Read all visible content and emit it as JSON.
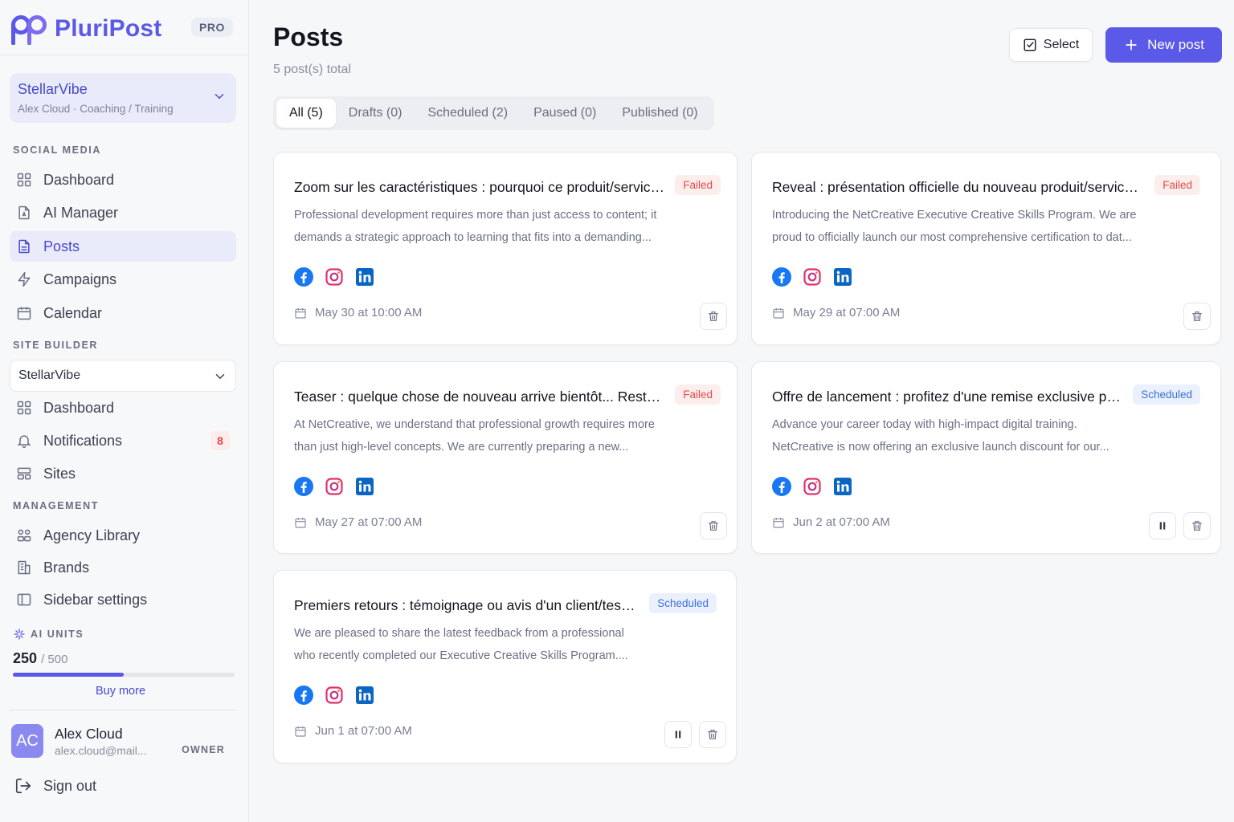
{
  "brand": {
    "name": "PluriPost",
    "badge": "PRO"
  },
  "workspace": {
    "name": "StellarVibe",
    "subtitle": "Alex Cloud · Coaching / Training"
  },
  "sidebar": {
    "social_label": "SOCIAL MEDIA",
    "social_items": [
      {
        "label": "Dashboard",
        "icon": "grid-icon"
      },
      {
        "label": "AI Manager",
        "icon": "document-ai-icon"
      },
      {
        "label": "Posts",
        "icon": "document-icon",
        "active": true
      },
      {
        "label": "Campaigns",
        "icon": "bolt-icon"
      },
      {
        "label": "Calendar",
        "icon": "calendar-icon"
      }
    ],
    "site_label": "SITE BUILDER",
    "site_select": "StellarVibe",
    "site_items": [
      {
        "label": "Dashboard",
        "icon": "grid-icon"
      },
      {
        "label": "Notifications",
        "icon": "bell-icon",
        "badge": "8"
      },
      {
        "label": "Sites",
        "icon": "layout-icon"
      }
    ],
    "management_label": "MANAGEMENT",
    "management_items": [
      {
        "label": "Agency Library",
        "icon": "library-icon"
      },
      {
        "label": "Brands",
        "icon": "building-icon"
      },
      {
        "label": "Sidebar settings",
        "icon": "sidebar-icon"
      }
    ],
    "ai_units": {
      "label": "AI UNITS",
      "used": "250",
      "total": "/ 500",
      "fraction": 0.5,
      "buy_more": "Buy more"
    },
    "user": {
      "initials": "AC",
      "name": "Alex Cloud",
      "email": "alex.cloud@mail...",
      "role": "OWNER"
    },
    "sign_out": "Sign out"
  },
  "header": {
    "title": "Posts",
    "subtitle": "5 post(s) total",
    "select_label": "Select",
    "new_post_label": "New post"
  },
  "tabs": [
    {
      "label": "All (5)",
      "active": true
    },
    {
      "label": "Drafts (0)"
    },
    {
      "label": "Scheduled (2)"
    },
    {
      "label": "Paused (0)"
    },
    {
      "label": "Published (0)"
    }
  ],
  "posts": [
    {
      "title": "Zoom sur les caractéristiques : pourquoi ce produit/service...",
      "status": "Failed",
      "desc1": "Professional development requires more than just access to content; it",
      "desc2": "demands a strategic approach to learning that fits into a demanding...",
      "date": "May 30 at 10:00 AM",
      "networks": [
        "facebook-icon",
        "instagram-icon",
        "linkedin-icon"
      ]
    },
    {
      "title": "Reveal : présentation officielle du nouveau produit/service ...",
      "status": "Failed",
      "desc1": "Introducing the NetCreative Executive Creative Skills Program. We are",
      "desc2": "proud to officially launch our most comprehensive certification to dat...",
      "date": "May 29 at 07:00 AM",
      "networks": [
        "facebook-icon",
        "instagram-icon",
        "linkedin-icon"
      ]
    },
    {
      "title": "Teaser : quelque chose de nouveau arrive bientôt... Restez ...",
      "status": "Failed",
      "desc1": "At NetCreative, we understand that professional growth requires more",
      "desc2": "than just high-level concepts. We are currently preparing a new...",
      "date": "May 27 at 07:00 AM",
      "networks": [
        "facebook-icon",
        "instagram-icon",
        "linkedin-icon"
      ]
    },
    {
      "title": "Offre de lancement : profitez d'une remise exclusive po...",
      "status": "Scheduled",
      "desc1": "Advance your career today with high-impact digital training.",
      "desc2": "NetCreative is now offering an exclusive launch discount for our...",
      "date": "Jun 2 at 07:00 AM",
      "networks": [
        "facebook-icon",
        "instagram-icon",
        "linkedin-icon"
      ]
    },
    {
      "title": "Premiers retours : témoignage ou avis d'un client/teste...",
      "status": "Scheduled",
      "desc1": "We are pleased to share the latest feedback from a professional",
      "desc2": "who recently completed our Executive Creative Skills Program....",
      "date": "Jun 1 at 07:00 AM",
      "networks": [
        "facebook-icon",
        "instagram-icon",
        "linkedin-icon"
      ]
    }
  ],
  "colors": {
    "accent": "#5a59e8",
    "failed": "#e24a4a",
    "scheduled": "#3d6fd8",
    "facebook": "#1877f2",
    "linkedin": "#0a66c2"
  }
}
